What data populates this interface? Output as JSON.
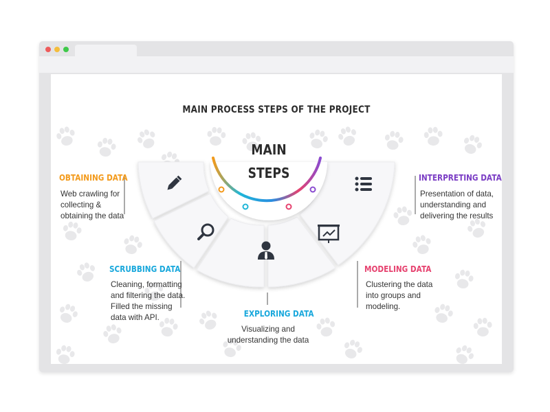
{
  "title": "MAIN PROCESS STEPS OF THE PROJECT",
  "center": {
    "line1": "MAIN",
    "line2": "STEPS"
  },
  "steps": [
    {
      "heading": "OBTAINING DATA",
      "description": "Web crawling for collecting & obtaining the data",
      "color": "#f39a1b",
      "icon": "pencil-icon"
    },
    {
      "heading": "SCRUBBING DATA",
      "description": "Cleaning, formatting and filtering the data. Filled the missing data with API.",
      "color": "#19a8dc",
      "icon": "magnifier-icon"
    },
    {
      "heading": "EXPLORING DATA",
      "description": "Visualizing and understanding the data",
      "color": "#19a8dc",
      "icon": "person-icon"
    },
    {
      "heading": "MODELING DATA",
      "description": "Clustering the data into groups and modeling.",
      "color": "#e6426f",
      "icon": "presentation-chart-icon"
    },
    {
      "heading": "INTERPRETING DATA",
      "description": "Presentation of data, understanding and delivering the results",
      "color": "#7a3cc4",
      "icon": "list-icon"
    }
  ],
  "arc_colors": [
    "#f39a1b",
    "#1fb6d8",
    "#2a8de0",
    "#e6426f",
    "#8a4bd0"
  ],
  "paw_color": "#e8e8ea"
}
